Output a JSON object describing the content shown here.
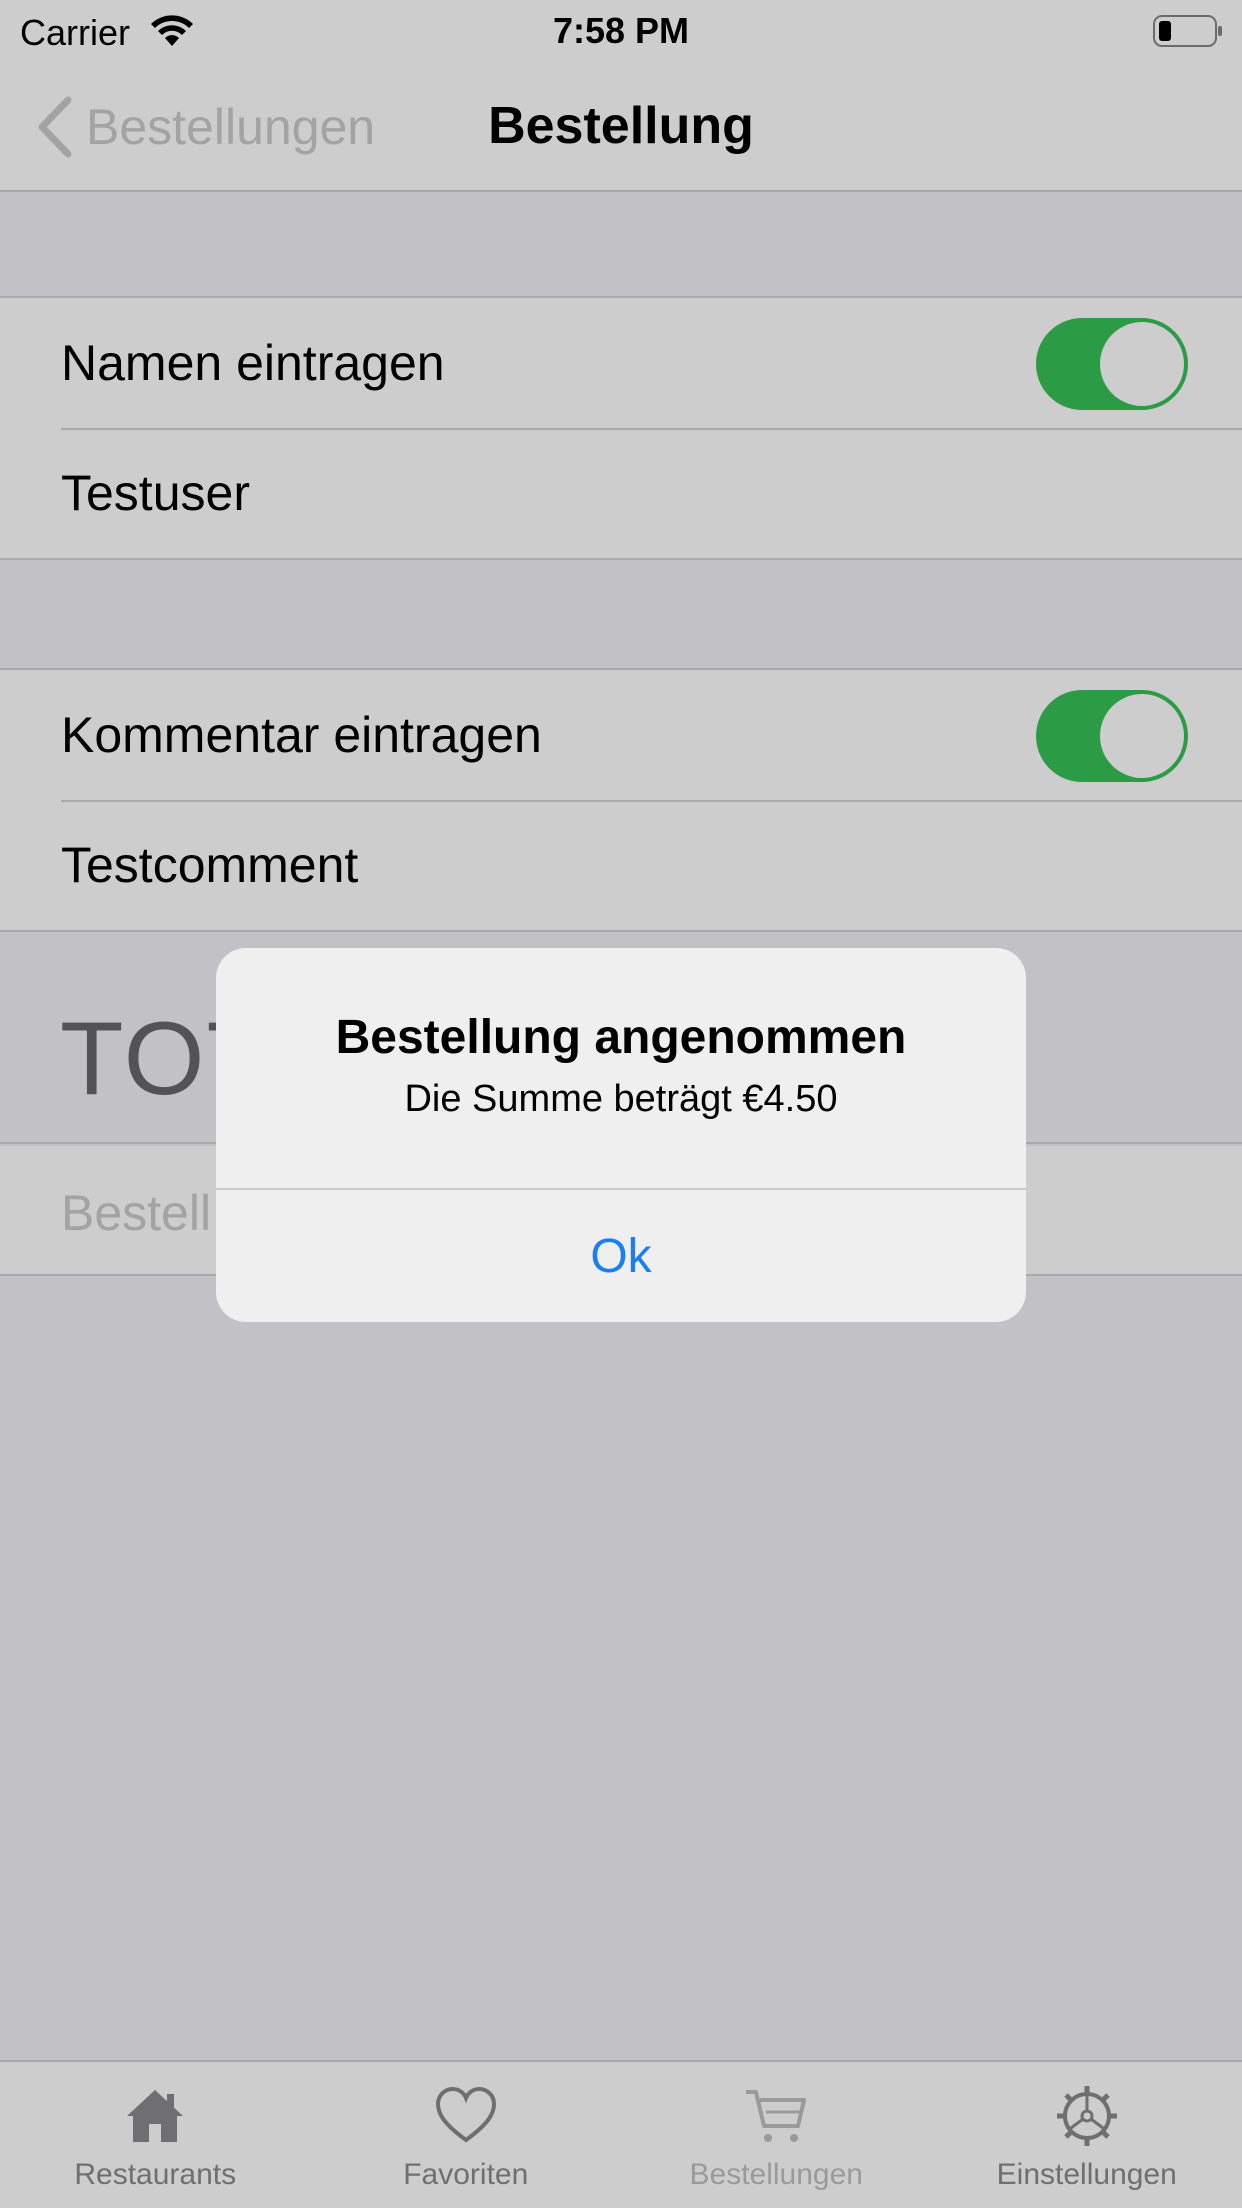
{
  "status_bar": {
    "carrier": "Carrier",
    "time": "7:58 PM",
    "wifi_icon": "wifi-icon",
    "battery_icon": "battery-low-icon"
  },
  "nav": {
    "back_label": "Bestellungen",
    "back_icon": "chevron-left-icon",
    "title": "Bestellung"
  },
  "name_section": {
    "toggle_label": "Namen eintragen",
    "toggle_on": true,
    "value": "Testuser"
  },
  "comment_section": {
    "toggle_label": "Kommentar eintragen",
    "toggle_on": true,
    "value": "Testcomment"
  },
  "total": {
    "label_visible": "TOT"
  },
  "order_button": {
    "label_visible": "Bestell"
  },
  "alert": {
    "title": "Bestellung angenommen",
    "message": "Die Summe beträgt €4.50",
    "button": "Ok"
  },
  "tab_bar": {
    "tabs": [
      {
        "label": "Restaurants",
        "icon": "house-icon"
      },
      {
        "label": "Favoriten",
        "icon": "heart-icon"
      },
      {
        "label": "Bestellungen",
        "icon": "cart-icon",
        "active": true
      },
      {
        "label": "Einstellungen",
        "icon": "gear-icon"
      }
    ]
  },
  "colors": {
    "toggle_on": "#2c9b46",
    "alert_button": "#1a7ff5",
    "dim_background": "#c2c1c6"
  }
}
